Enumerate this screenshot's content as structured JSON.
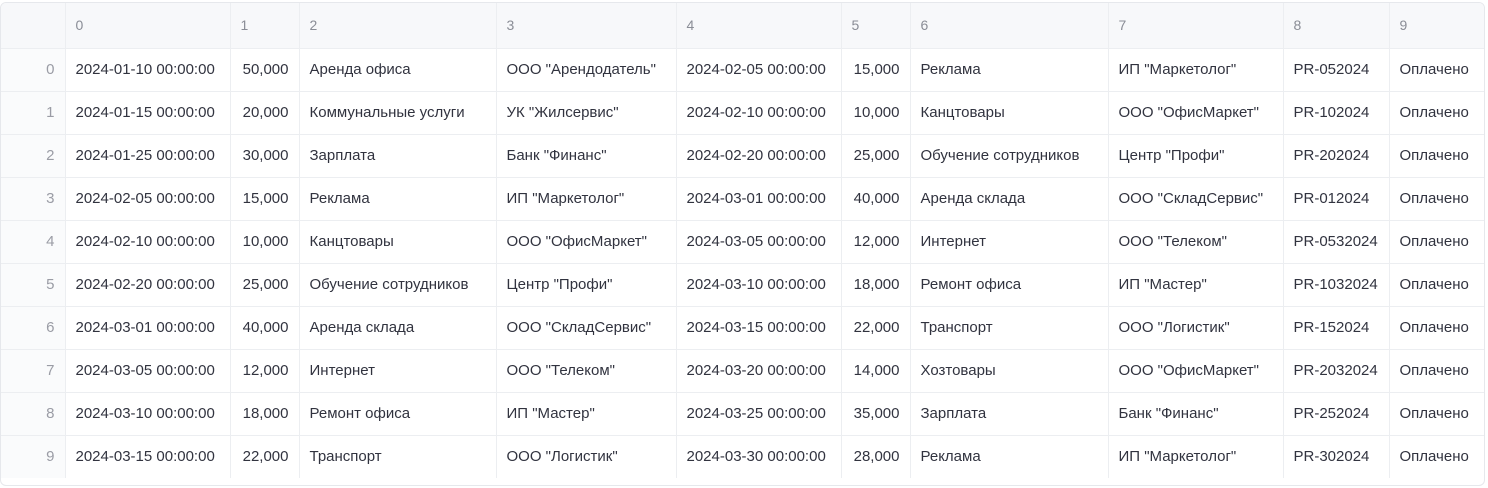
{
  "table": {
    "columns": [
      "0",
      "1",
      "2",
      "3",
      "4",
      "5",
      "6",
      "7",
      "8",
      "9"
    ],
    "rows": [
      {
        "index": "0",
        "cells": [
          "2024-01-10 00:00:00",
          "50,000",
          "Аренда офиса",
          "ООО \"Арендодатель\"",
          "2024-02-05 00:00:00",
          "15,000",
          "Реклама",
          "ИП \"Маркетолог\"",
          "PR-052024",
          "Оплачено"
        ]
      },
      {
        "index": "1",
        "cells": [
          "2024-01-15 00:00:00",
          "20,000",
          "Коммунальные услуги",
          "УК \"Жилсервис\"",
          "2024-02-10 00:00:00",
          "10,000",
          "Канцтовары",
          "ООО \"ОфисМаркет\"",
          "PR-102024",
          "Оплачено"
        ]
      },
      {
        "index": "2",
        "cells": [
          "2024-01-25 00:00:00",
          "30,000",
          "Зарплата",
          "Банк \"Финанс\"",
          "2024-02-20 00:00:00",
          "25,000",
          "Обучение сотрудников",
          "Центр \"Профи\"",
          "PR-202024",
          "Оплачено"
        ]
      },
      {
        "index": "3",
        "cells": [
          "2024-02-05 00:00:00",
          "15,000",
          "Реклама",
          "ИП \"Маркетолог\"",
          "2024-03-01 00:00:00",
          "40,000",
          "Аренда склада",
          "ООО \"СкладСервис\"",
          "PR-012024",
          "Оплачено"
        ]
      },
      {
        "index": "4",
        "cells": [
          "2024-02-10 00:00:00",
          "10,000",
          "Канцтовары",
          "ООО \"ОфисМаркет\"",
          "2024-03-05 00:00:00",
          "12,000",
          "Интернет",
          "ООО \"Телеком\"",
          "PR-0532024",
          "Оплачено"
        ]
      },
      {
        "index": "5",
        "cells": [
          "2024-02-20 00:00:00",
          "25,000",
          "Обучение сотрудников",
          "Центр \"Профи\"",
          "2024-03-10 00:00:00",
          "18,000",
          "Ремонт офиса",
          "ИП \"Мастер\"",
          "PR-1032024",
          "Оплачено"
        ]
      },
      {
        "index": "6",
        "cells": [
          "2024-03-01 00:00:00",
          "40,000",
          "Аренда склада",
          "ООО \"СкладСервис\"",
          "2024-03-15 00:00:00",
          "22,000",
          "Транспорт",
          "ООО \"Логистик\"",
          "PR-152024",
          "Оплачено"
        ]
      },
      {
        "index": "7",
        "cells": [
          "2024-03-05 00:00:00",
          "12,000",
          "Интернет",
          "ООО \"Телеком\"",
          "2024-03-20 00:00:00",
          "14,000",
          "Хозтовары",
          "ООО \"ОфисМаркет\"",
          "PR-2032024",
          "Оплачено"
        ]
      },
      {
        "index": "8",
        "cells": [
          "2024-03-10 00:00:00",
          "18,000",
          "Ремонт офиса",
          "ИП \"Мастер\"",
          "2024-03-25 00:00:00",
          "35,000",
          "Зарплата",
          "Банк \"Финанс\"",
          "PR-252024",
          "Оплачено"
        ]
      },
      {
        "index": "9",
        "cells": [
          "2024-03-15 00:00:00",
          "22,000",
          "Транспорт",
          "ООО \"Логистик\"",
          "2024-03-30 00:00:00",
          "28,000",
          "Реклама",
          "ИП \"Маркетолог\"",
          "PR-302024",
          "Оплачено"
        ]
      }
    ]
  }
}
